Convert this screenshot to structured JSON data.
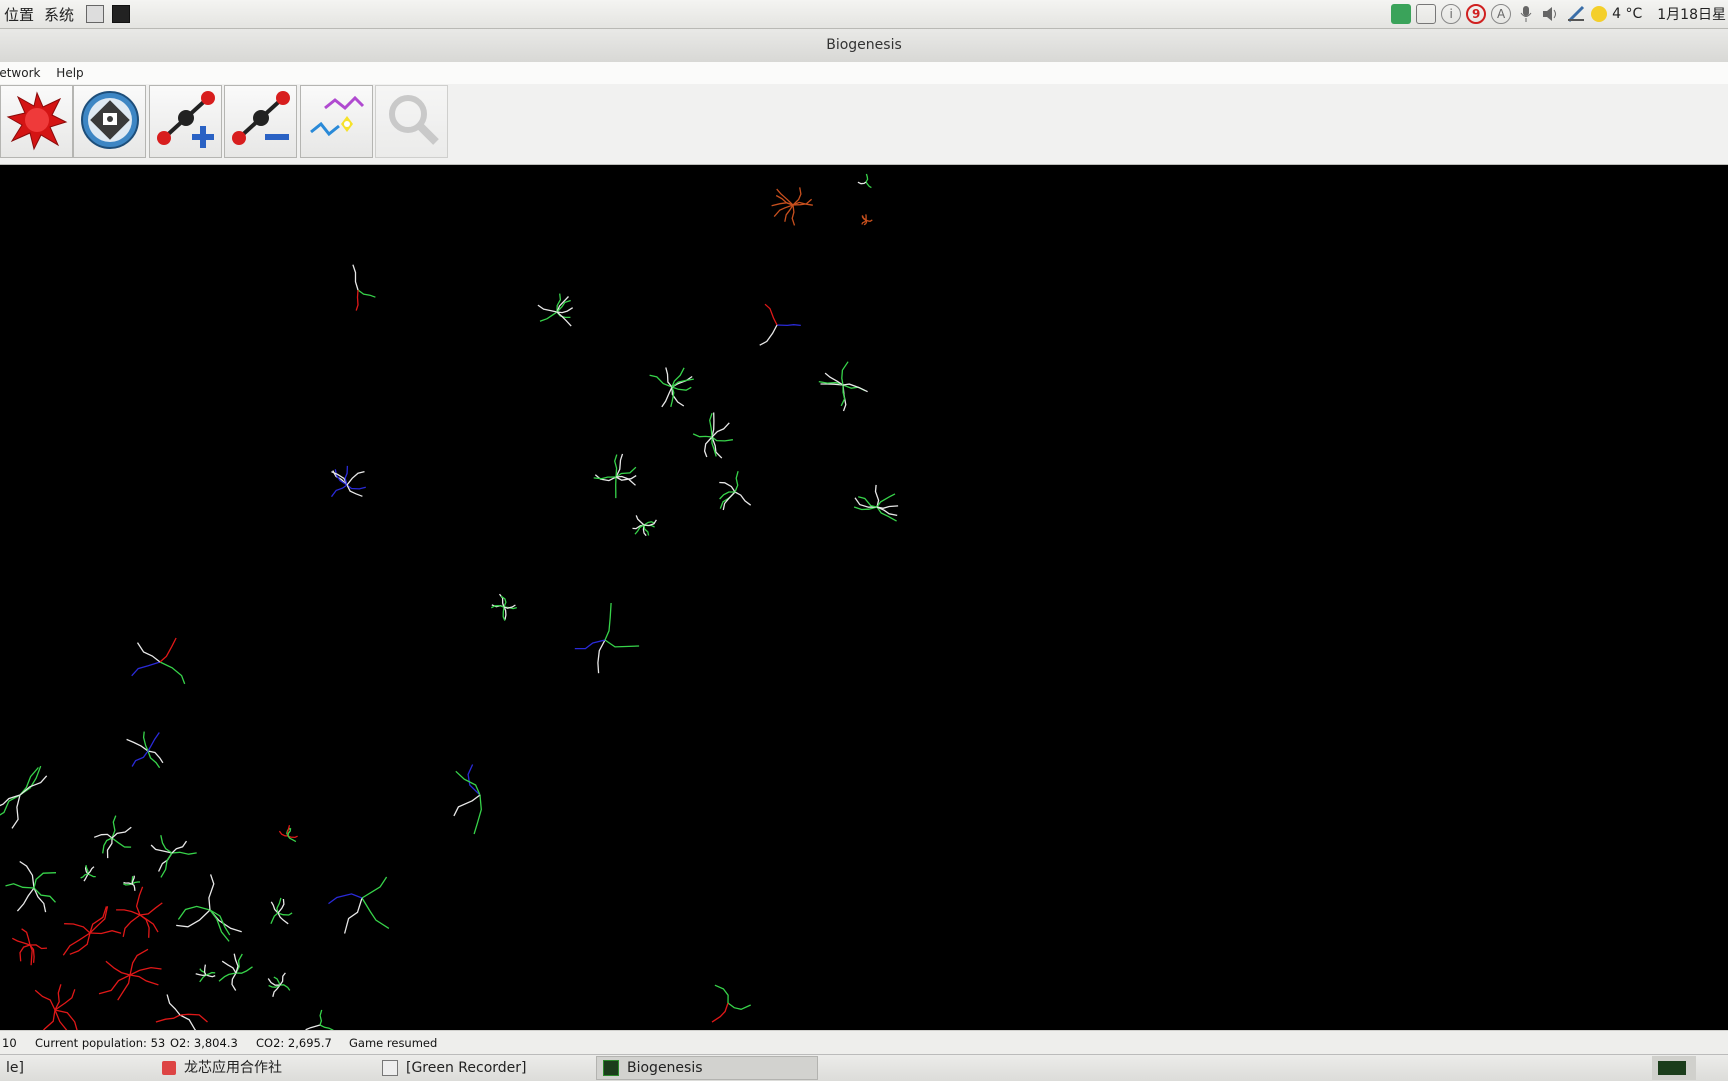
{
  "top_panel": {
    "menus": [
      "位置",
      "系统"
    ],
    "tray": {
      "notification_count": "9",
      "circle_a": "A",
      "circle_i": "i",
      "temperature": "4 °C",
      "date": "1月18日星"
    }
  },
  "window": {
    "title": "Biogenesis"
  },
  "menubar": {
    "items": [
      "letwork",
      "Help"
    ]
  },
  "toolbar": {
    "buttons": [
      {
        "name": "new-world-button",
        "icon": "red-splat-icon",
        "enabled": true
      },
      {
        "name": "save-button",
        "icon": "disk-icon",
        "enabled": true
      },
      {
        "name": "increase-co2-button",
        "icon": "co2-plus-icon",
        "enabled": true
      },
      {
        "name": "decrease-co2-button",
        "icon": "co2-minus-icon",
        "enabled": true
      },
      {
        "name": "manipulate-button",
        "icon": "organism-spark-icon",
        "enabled": true
      },
      {
        "name": "examine-button",
        "icon": "magnifier-icon",
        "enabled": false
      }
    ]
  },
  "status": {
    "time": "10",
    "population": "Current population: 53",
    "o2": "O2: 3,804.3",
    "co2": "CO2: 2,695.7",
    "state": "Game resumed"
  },
  "taskbar": {
    "items": [
      "le]",
      "龙芯应用合作社",
      "[Green Recorder]",
      "Biogenesis"
    ],
    "active": "Biogenesis"
  },
  "colors": {
    "world_bg": "#000000",
    "organism_green": "#37d34a",
    "organism_white": "#e8e8e8",
    "organism_red": "#e01818",
    "organism_blue": "#2a2ad8",
    "organism_orange": "#c8501e"
  }
}
